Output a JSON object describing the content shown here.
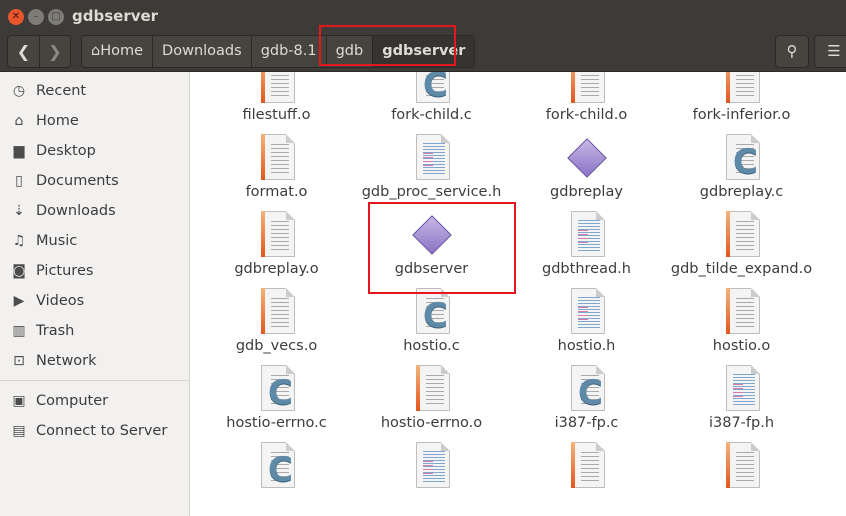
{
  "window": {
    "title": "gdbserver"
  },
  "toolbar": {
    "back_icon": "chevron-left-icon",
    "forward_icon": "chevron-right-icon",
    "breadcrumbs": [
      "Home",
      "Downloads",
      "gdb-8.1",
      "gdb",
      "gdbserver"
    ],
    "search_icon": "search-icon",
    "view_icon": "list-view-icon"
  },
  "sidebar": {
    "items": [
      {
        "label": "Recent",
        "icon": "clock-icon",
        "glyph": "◷"
      },
      {
        "label": "Home",
        "icon": "home-icon",
        "glyph": "⌂"
      },
      {
        "label": "Desktop",
        "icon": "folder-icon",
        "glyph": "▆"
      },
      {
        "label": "Documents",
        "icon": "document-icon",
        "glyph": "▯"
      },
      {
        "label": "Downloads",
        "icon": "download-icon",
        "glyph": "⇣"
      },
      {
        "label": "Music",
        "icon": "music-icon",
        "glyph": "♫"
      },
      {
        "label": "Pictures",
        "icon": "camera-icon",
        "glyph": "◙"
      },
      {
        "label": "Videos",
        "icon": "video-icon",
        "glyph": "▶"
      },
      {
        "label": "Trash",
        "icon": "trash-icon",
        "glyph": "▥"
      },
      {
        "label": "Network",
        "icon": "network-icon",
        "glyph": "⊡"
      },
      {
        "label": "Computer",
        "icon": "computer-icon",
        "glyph": "▣"
      },
      {
        "label": "Connect to Server",
        "icon": "server-icon",
        "glyph": "▤"
      }
    ]
  },
  "files": [
    {
      "name": "filestuff.o",
      "type": "o"
    },
    {
      "name": "fork-child.c",
      "type": "c"
    },
    {
      "name": "fork-child.o",
      "type": "o"
    },
    {
      "name": "fork-inferior.o",
      "type": "o"
    },
    {
      "name": "format.o",
      "type": "o"
    },
    {
      "name": "gdb_proc_service.h",
      "type": "h"
    },
    {
      "name": "gdbreplay",
      "type": "exe"
    },
    {
      "name": "gdbreplay.c",
      "type": "c"
    },
    {
      "name": "gdbreplay.o",
      "type": "o"
    },
    {
      "name": "gdbserver",
      "type": "exe"
    },
    {
      "name": "gdbthread.h",
      "type": "h"
    },
    {
      "name": "gdb_tilde_expand.o",
      "type": "o"
    },
    {
      "name": "gdb_vecs.o",
      "type": "o"
    },
    {
      "name": "hostio.c",
      "type": "c"
    },
    {
      "name": "hostio.h",
      "type": "h"
    },
    {
      "name": "hostio.o",
      "type": "o"
    },
    {
      "name": "hostio-errno.c",
      "type": "c"
    },
    {
      "name": "hostio-errno.o",
      "type": "o"
    },
    {
      "name": "i387-fp.c",
      "type": "c"
    },
    {
      "name": "i387-fp.h",
      "type": "h"
    },
    {
      "name": "",
      "type": "c"
    },
    {
      "name": "",
      "type": "h"
    },
    {
      "name": "",
      "type": "o"
    },
    {
      "name": "",
      "type": "o"
    }
  ],
  "colors": {
    "highlight": "#e4171e",
    "chrome": "#3c3b37"
  }
}
